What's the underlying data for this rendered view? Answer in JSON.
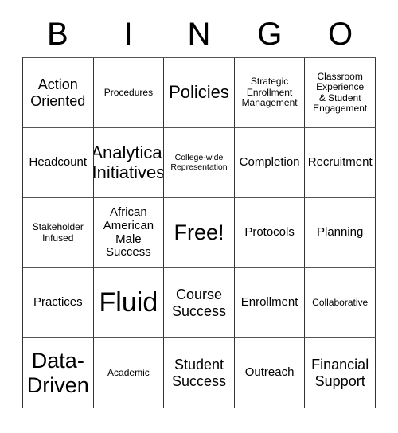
{
  "card": {
    "title": "BINGO",
    "header_letters": [
      "B",
      "I",
      "N",
      "G",
      "O"
    ],
    "free_space_label": "Free!",
    "rows": [
      [
        {
          "text": "Action\nOriented",
          "size": "fs-lg"
        },
        {
          "text": "Procedures",
          "size": "fs-sm"
        },
        {
          "text": "Policies",
          "size": "fs-xl"
        },
        {
          "text": "Strategic\nEnrollment\nManagement",
          "size": "fs-sm"
        },
        {
          "text": "Classroom\nExperience\n& Student\nEngagement",
          "size": "fs-sm"
        }
      ],
      [
        {
          "text": "Headcount",
          "size": "fs-md"
        },
        {
          "text": "Analytical\nInitiatives",
          "size": "fs-xl"
        },
        {
          "text": "College-wide\nRepresentation",
          "size": "fs-xs"
        },
        {
          "text": "Completion",
          "size": "fs-md"
        },
        {
          "text": "Recruitment",
          "size": "fs-md"
        }
      ],
      [
        {
          "text": "Stakeholder\nInfused",
          "size": "fs-sm"
        },
        {
          "text": "African\nAmerican\nMale\nSuccess",
          "size": "fs-md"
        },
        {
          "text": "Free!",
          "size": "fs-xxl"
        },
        {
          "text": "Protocols",
          "size": "fs-md"
        },
        {
          "text": "Planning",
          "size": "fs-md"
        }
      ],
      [
        {
          "text": "Practices",
          "size": "fs-md"
        },
        {
          "text": "Fluid",
          "size": "fs-huge"
        },
        {
          "text": "Course\nSuccess",
          "size": "fs-lg"
        },
        {
          "text": "Enrollment",
          "size": "fs-md"
        },
        {
          "text": "Collaborative",
          "size": "fs-sm"
        }
      ],
      [
        {
          "text": "Data-\nDriven",
          "size": "fs-xxl"
        },
        {
          "text": "Academic",
          "size": "fs-sm"
        },
        {
          "text": "Student\nSuccess",
          "size": "fs-lg"
        },
        {
          "text": "Outreach",
          "size": "fs-md"
        },
        {
          "text": "Financial\nSupport",
          "size": "fs-lg"
        }
      ]
    ]
  },
  "colors": {
    "background": "#ffffff",
    "text": "#000000",
    "grid_line": "#333333"
  }
}
